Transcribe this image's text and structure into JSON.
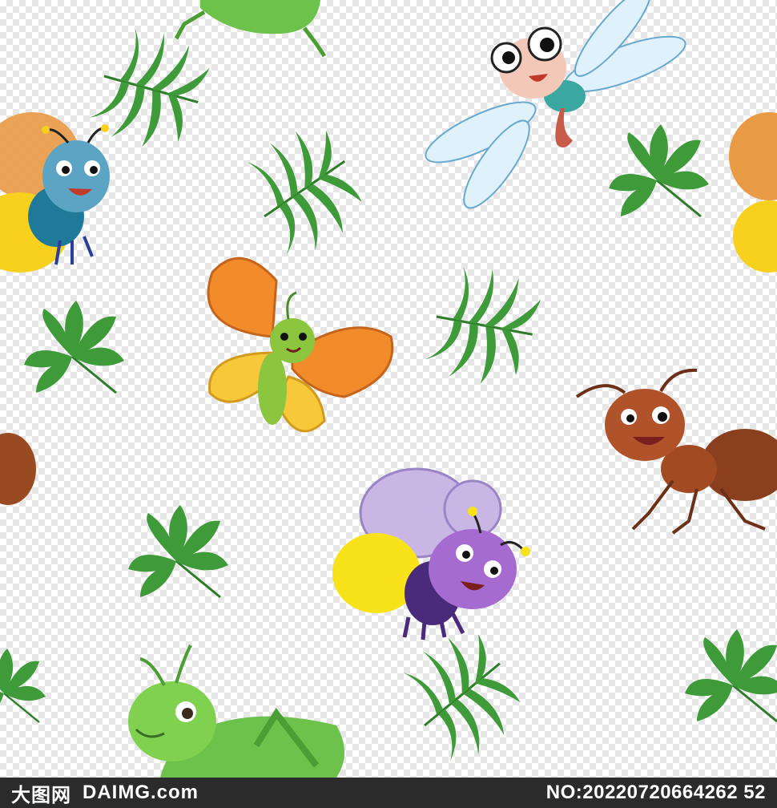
{
  "scene": {
    "subjects": [
      "grasshopper-icon",
      "dragonfly-icon",
      "firefly-icon",
      "butterfly-icon",
      "ant-icon",
      "bee-icon",
      "leaf-icon"
    ]
  },
  "watermark": {
    "site_cn": "大图网",
    "site_en": "DAIMG.com",
    "number": "NO:20220720664262 52"
  },
  "colors": {
    "leaf": "#3f9b3a",
    "watermark_bar": "#2b2b2b"
  }
}
